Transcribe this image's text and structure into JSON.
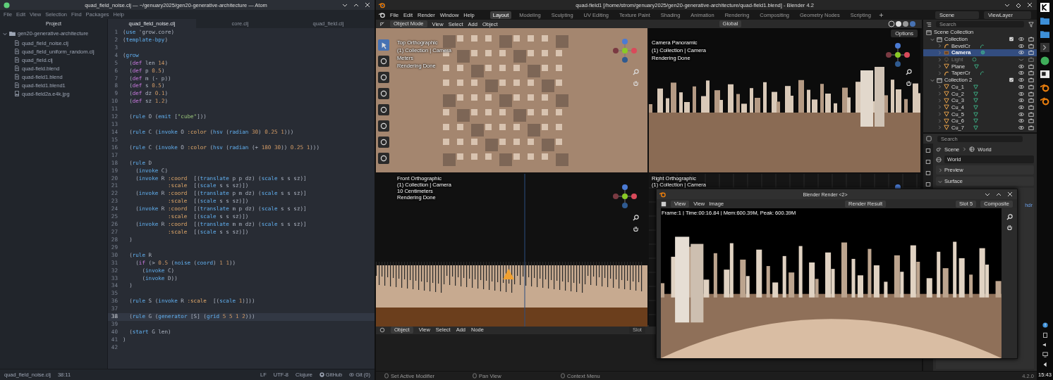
{
  "atom": {
    "title": "quad_field_noise.clj — ~/genuary2025/gen20-generative-architecture — Atom",
    "menu": [
      "File",
      "Edit",
      "View",
      "Selection",
      "Find",
      "Packages",
      "Help"
    ],
    "project": {
      "heading": "Project",
      "folder": {
        "name": "gen20-generative-architecture",
        "expanded": true,
        "children": [
          {
            "name": "quad_field_noise.clj",
            "kind": "file"
          },
          {
            "name": "quad_field_uniform_random.clj",
            "kind": "file"
          },
          {
            "name": "quad_field.clj",
            "kind": "file"
          },
          {
            "name": "quad-field.blend",
            "kind": "file"
          },
          {
            "name": "quad-field1.blend",
            "kind": "file"
          },
          {
            "name": "quad-field1.blend1",
            "kind": "file"
          },
          {
            "name": "quad-field2a.e4k.jpg",
            "kind": "image"
          }
        ]
      }
    },
    "tabs": [
      {
        "label": "quad_field_noise.clj",
        "selected": true
      },
      {
        "label": "core.clj",
        "selected": false
      },
      {
        "label": "quad_field.clj",
        "selected": false
      }
    ],
    "code": [
      {
        "no": "1",
        "current": false,
        "tokens": [
          {
            "kind": "p",
            "text": "("
          },
          {
            "kind": "fn",
            "text": "use"
          },
          {
            "kind": "p",
            "text": " 'grow.core)"
          }
        ]
      },
      {
        "no": "2",
        "current": false,
        "tokens": [
          {
            "kind": "p",
            "text": "("
          },
          {
            "kind": "fn",
            "text": "template-bpy"
          },
          {
            "kind": "p",
            "text": ")"
          }
        ]
      },
      {
        "no": "3",
        "current": false
      },
      {
        "no": "4",
        "current": false,
        "tokens": [
          {
            "kind": "p",
            "text": "("
          },
          {
            "kind": "fn",
            "text": "grow"
          }
        ]
      },
      {
        "no": "5",
        "current": false,
        "tokens": [
          {
            "kind": "p",
            "text": "  ("
          },
          {
            "kind": "kw",
            "text": "def"
          },
          {
            "kind": "p",
            "text": " len "
          },
          {
            "kind": "num",
            "text": "14"
          },
          {
            "kind": "p",
            "text": ")"
          }
        ]
      },
      {
        "no": "6",
        "current": false,
        "tokens": [
          {
            "kind": "p",
            "text": "  ("
          },
          {
            "kind": "kw",
            "text": "def"
          },
          {
            "kind": "p",
            "text": " p "
          },
          {
            "kind": "num",
            "text": "0.5"
          },
          {
            "kind": "p",
            "text": ")"
          }
        ]
      },
      {
        "no": "7",
        "current": false,
        "tokens": [
          {
            "kind": "p",
            "text": "  ("
          },
          {
            "kind": "kw",
            "text": "def"
          },
          {
            "kind": "p",
            "text": " m (- p))"
          }
        ]
      },
      {
        "no": "8",
        "current": false,
        "tokens": [
          {
            "kind": "p",
            "text": "  ("
          },
          {
            "kind": "kw",
            "text": "def"
          },
          {
            "kind": "p",
            "text": " s "
          },
          {
            "kind": "num",
            "text": "0.5"
          },
          {
            "kind": "p",
            "text": ")"
          }
        ]
      },
      {
        "no": "9",
        "current": false,
        "tokens": [
          {
            "kind": "p",
            "text": "  ("
          },
          {
            "kind": "kw",
            "text": "def"
          },
          {
            "kind": "p",
            "text": " dz "
          },
          {
            "kind": "num",
            "text": "0.1"
          },
          {
            "kind": "p",
            "text": ")"
          }
        ]
      },
      {
        "no": "10",
        "current": false,
        "tokens": [
          {
            "kind": "p",
            "text": "  ("
          },
          {
            "kind": "kw",
            "text": "def"
          },
          {
            "kind": "p",
            "text": " sz "
          },
          {
            "kind": "num",
            "text": "1.2"
          },
          {
            "kind": "p",
            "text": ")"
          }
        ]
      },
      {
        "no": "11",
        "current": false
      },
      {
        "no": "12",
        "current": false,
        "tokens": [
          {
            "kind": "p",
            "text": "  ("
          },
          {
            "kind": "fn",
            "text": "rule"
          },
          {
            "kind": "p",
            "text": " O ("
          },
          {
            "kind": "fn",
            "text": "emit"
          },
          {
            "kind": "p",
            "text": " ["
          },
          {
            "kind": "str",
            "text": "\"cube\""
          },
          {
            "kind": "p",
            "text": "]))"
          }
        ]
      },
      {
        "no": "13",
        "current": false
      },
      {
        "no": "14",
        "current": false,
        "tokens": [
          {
            "kind": "p",
            "text": "  ("
          },
          {
            "kind": "fn",
            "text": "rule"
          },
          {
            "kind": "p",
            "text": " C ("
          },
          {
            "kind": "fn",
            "text": "invoke"
          },
          {
            "kind": "p",
            "text": " O "
          },
          {
            "kind": "key",
            "text": ":color"
          },
          {
            "kind": "p",
            "text": " ("
          },
          {
            "kind": "fn",
            "text": "hsv"
          },
          {
            "kind": "p",
            "text": " ("
          },
          {
            "kind": "fn",
            "text": "radian "
          },
          {
            "kind": "num",
            "text": "30"
          },
          {
            "kind": "p",
            "text": ") "
          },
          {
            "kind": "num",
            "text": "0.25 "
          },
          {
            "kind": "num",
            "text": "1"
          },
          {
            "kind": "p",
            "text": ")))"
          }
        ]
      },
      {
        "no": "15",
        "current": false
      },
      {
        "no": "16",
        "current": false,
        "tokens": [
          {
            "kind": "p",
            "text": "  ("
          },
          {
            "kind": "fn",
            "text": "rule"
          },
          {
            "kind": "p",
            "text": " C ("
          },
          {
            "kind": "fn",
            "text": "invoke"
          },
          {
            "kind": "p",
            "text": " O "
          },
          {
            "kind": "key",
            "text": ":color"
          },
          {
            "kind": "p",
            "text": " ("
          },
          {
            "kind": "fn",
            "text": "hsv"
          },
          {
            "kind": "p",
            "text": " ("
          },
          {
            "kind": "fn",
            "text": "radian"
          },
          {
            "kind": "p",
            "text": " (+ "
          },
          {
            "kind": "num",
            "text": "180 "
          },
          {
            "kind": "num",
            "text": "30"
          },
          {
            "kind": "p",
            "text": ")) "
          },
          {
            "kind": "num",
            "text": "0.25 "
          },
          {
            "kind": "num",
            "text": "1"
          },
          {
            "kind": "p",
            "text": ")))"
          }
        ]
      },
      {
        "no": "17",
        "current": false
      },
      {
        "no": "18",
        "current": false,
        "tokens": [
          {
            "kind": "p",
            "text": "  ("
          },
          {
            "kind": "fn",
            "text": "rule"
          },
          {
            "kind": "p",
            "text": " D"
          }
        ]
      },
      {
        "no": "19",
        "current": false,
        "tokens": [
          {
            "kind": "p",
            "text": "    ("
          },
          {
            "kind": "fn",
            "text": "invoke"
          },
          {
            "kind": "p",
            "text": " C)"
          }
        ]
      },
      {
        "no": "20",
        "current": false,
        "tokens": [
          {
            "kind": "p",
            "text": "    ("
          },
          {
            "kind": "fn",
            "text": "invoke"
          },
          {
            "kind": "p",
            "text": " R "
          },
          {
            "kind": "key",
            "text": ":coord"
          },
          {
            "kind": "p",
            "text": "  [("
          },
          {
            "kind": "fn",
            "text": "translate"
          },
          {
            "kind": "p",
            "text": " p p dz) ("
          },
          {
            "kind": "fn",
            "text": "scale"
          },
          {
            "kind": "p",
            "text": " s s sz)]"
          }
        ]
      },
      {
        "no": "21",
        "current": false,
        "tokens": [
          {
            "kind": "key",
            "text": "              :scale"
          },
          {
            "kind": "p",
            "text": "  [("
          },
          {
            "kind": "fn",
            "text": "scale"
          },
          {
            "kind": "p",
            "text": " s s sz)])"
          }
        ]
      },
      {
        "no": "22",
        "current": false,
        "tokens": [
          {
            "kind": "p",
            "text": "    ("
          },
          {
            "kind": "fn",
            "text": "invoke"
          },
          {
            "kind": "p",
            "text": " R "
          },
          {
            "kind": "key",
            "text": ":coord"
          },
          {
            "kind": "p",
            "text": "  [("
          },
          {
            "kind": "fn",
            "text": "translate"
          },
          {
            "kind": "p",
            "text": " p m dz) ("
          },
          {
            "kind": "fn",
            "text": "scale"
          },
          {
            "kind": "p",
            "text": " s s sz)]"
          }
        ]
      },
      {
        "no": "23",
        "current": false,
        "tokens": [
          {
            "kind": "key",
            "text": "              :scale"
          },
          {
            "kind": "p",
            "text": "  [("
          },
          {
            "kind": "fn",
            "text": "scale"
          },
          {
            "kind": "p",
            "text": " s s sz)])"
          }
        ]
      },
      {
        "no": "24",
        "current": false,
        "tokens": [
          {
            "kind": "p",
            "text": "    ("
          },
          {
            "kind": "fn",
            "text": "invoke"
          },
          {
            "kind": "p",
            "text": " R "
          },
          {
            "kind": "key",
            "text": ":coord"
          },
          {
            "kind": "p",
            "text": "  [("
          },
          {
            "kind": "fn",
            "text": "translate"
          },
          {
            "kind": "p",
            "text": " m p dz) ("
          },
          {
            "kind": "fn",
            "text": "scale"
          },
          {
            "kind": "p",
            "text": " s s sz)]"
          }
        ]
      },
      {
        "no": "25",
        "current": false,
        "tokens": [
          {
            "kind": "key",
            "text": "              :scale"
          },
          {
            "kind": "p",
            "text": "  [("
          },
          {
            "kind": "fn",
            "text": "scale"
          },
          {
            "kind": "p",
            "text": " s s sz)])"
          }
        ]
      },
      {
        "no": "26",
        "current": false,
        "tokens": [
          {
            "kind": "p",
            "text": "    ("
          },
          {
            "kind": "fn",
            "text": "invoke"
          },
          {
            "kind": "p",
            "text": " R "
          },
          {
            "kind": "key",
            "text": ":coord"
          },
          {
            "kind": "p",
            "text": "  [("
          },
          {
            "kind": "fn",
            "text": "translate"
          },
          {
            "kind": "p",
            "text": " m m dz) ("
          },
          {
            "kind": "fn",
            "text": "scale"
          },
          {
            "kind": "p",
            "text": " s s sz)]"
          }
        ]
      },
      {
        "no": "27",
        "current": false,
        "tokens": [
          {
            "kind": "key",
            "text": "              :scale"
          },
          {
            "kind": "p",
            "text": "  [("
          },
          {
            "kind": "fn",
            "text": "scale"
          },
          {
            "kind": "p",
            "text": " s s sz)])"
          }
        ]
      },
      {
        "no": "28",
        "current": false,
        "tokens": [
          {
            "kind": "p",
            "text": "  )"
          }
        ]
      },
      {
        "no": "29",
        "current": false
      },
      {
        "no": "30",
        "current": false,
        "tokens": [
          {
            "kind": "p",
            "text": "  ("
          },
          {
            "kind": "fn",
            "text": "rule"
          },
          {
            "kind": "p",
            "text": " R"
          }
        ]
      },
      {
        "no": "31",
        "current": false,
        "tokens": [
          {
            "kind": "p",
            "text": "    ("
          },
          {
            "kind": "kw",
            "text": "if"
          },
          {
            "kind": "p",
            "text": " (> "
          },
          {
            "kind": "num",
            "text": "0.5"
          },
          {
            "kind": "p",
            "text": " ("
          },
          {
            "kind": "fn",
            "text": "noise"
          },
          {
            "kind": "p",
            "text": " ("
          },
          {
            "kind": "fn",
            "text": "coord"
          },
          {
            "kind": "p",
            "text": ") "
          },
          {
            "kind": "num",
            "text": "1 "
          },
          {
            "kind": "num",
            "text": "1"
          },
          {
            "kind": "p",
            "text": "))"
          }
        ]
      },
      {
        "no": "32",
        "current": false,
        "tokens": [
          {
            "kind": "p",
            "text": "      ("
          },
          {
            "kind": "fn",
            "text": "invoke"
          },
          {
            "kind": "p",
            "text": " C)"
          }
        ]
      },
      {
        "no": "33",
        "current": false,
        "tokens": [
          {
            "kind": "p",
            "text": "      ("
          },
          {
            "kind": "fn",
            "text": "invoke"
          },
          {
            "kind": "p",
            "text": " D))"
          }
        ]
      },
      {
        "no": "34",
        "current": false,
        "tokens": [
          {
            "kind": "p",
            "text": "  )"
          }
        ]
      },
      {
        "no": "35",
        "current": false
      },
      {
        "no": "36",
        "current": false,
        "tokens": [
          {
            "kind": "p",
            "text": "  ("
          },
          {
            "kind": "fn",
            "text": "rule"
          },
          {
            "kind": "p",
            "text": " S ("
          },
          {
            "kind": "fn",
            "text": "invoke"
          },
          {
            "kind": "p",
            "text": " R "
          },
          {
            "kind": "key",
            "text": ":scale"
          },
          {
            "kind": "p",
            "text": "  [("
          },
          {
            "kind": "fn",
            "text": "scale "
          },
          {
            "kind": "num",
            "text": "1"
          },
          {
            "kind": "p",
            "text": ")]))"
          }
        ]
      },
      {
        "no": "37",
        "current": false
      },
      {
        "no": "38",
        "current": true,
        "tokens": [
          {
            "kind": "p",
            "text": "  ("
          },
          {
            "kind": "fn",
            "text": "rule"
          },
          {
            "kind": "p",
            "text": " G ("
          },
          {
            "kind": "fn",
            "text": "generator"
          },
          {
            "kind": "p",
            "text": " [S] ("
          },
          {
            "kind": "fn",
            "text": "grid "
          },
          {
            "kind": "num",
            "text": "5 "
          },
          {
            "kind": "num",
            "text": "5 "
          },
          {
            "kind": "num",
            "text": "1 "
          },
          {
            "kind": "num",
            "text": "2"
          },
          {
            "kind": "p",
            "text": ")))"
          }
        ]
      },
      {
        "no": "39",
        "current": false
      },
      {
        "no": "40",
        "current": false,
        "tokens": [
          {
            "kind": "p",
            "text": "  ("
          },
          {
            "kind": "fn",
            "text": "start"
          },
          {
            "kind": "p",
            "text": " G len)"
          }
        ]
      },
      {
        "no": "41",
        "current": false,
        "tokens": [
          {
            "kind": "p",
            "text": ")"
          }
        ]
      },
      {
        "no": "42",
        "current": false
      }
    ],
    "status_bar": {
      "file": "quad_field_noise.clj",
      "cursor": "38:11",
      "items": [
        {
          "kind": "text",
          "label": "LF"
        },
        {
          "kind": "text",
          "label": "UTF-8"
        },
        {
          "kind": "text",
          "label": "Clojure"
        },
        {
          "kind": "github",
          "label": "GitHub"
        },
        {
          "kind": "git",
          "label": "Git (0)"
        }
      ]
    }
  },
  "blender": {
    "title": "quad-field1 [/home/strom/genuary2025/gen20-generative-architecture/quad-field1.blend] - Blender 4.2",
    "menu": [
      "File",
      "Edit",
      "Render",
      "Window",
      "Help"
    ],
    "workspaces": [
      {
        "label": "Layout",
        "selected": true
      },
      {
        "label": "Modeling",
        "selected": false
      },
      {
        "label": "Sculpting",
        "selected": false
      },
      {
        "label": "UV Editing",
        "selected": false
      },
      {
        "label": "Texture Paint",
        "selected": false
      },
      {
        "label": "Shading",
        "selected": false
      },
      {
        "label": "Animation",
        "selected": false
      },
      {
        "label": "Rendering",
        "selected": false
      },
      {
        "label": "Compositing",
        "selected": false
      },
      {
        "label": "Geometry Nodes",
        "selected": false
      },
      {
        "label": "Scripting",
        "selected": false
      }
    ],
    "scene": "Scene",
    "view_layer": "ViewLayer",
    "viewport_header": {
      "mode": "Object Mode",
      "menu": [
        "View",
        "Select",
        "Add",
        "Object"
      ],
      "orientation": "Global",
      "options": "Options"
    },
    "viewports": [
      {
        "kind": "top",
        "overlay": [
          "Top Orthographic",
          "(1) Collection | Camera",
          "Meters",
          "Rendering Done"
        ]
      },
      {
        "kind": "camera",
        "overlay": [
          "Camera Panoramic",
          "(1) Collection | Camera",
          "Rendering Done"
        ]
      },
      {
        "kind": "front",
        "overlay": [
          "Front Orthographic",
          "(1) Collection | Camera",
          "10 Centimeters",
          "Rendering Done"
        ]
      },
      {
        "kind": "right",
        "overlay": [
          "Right Orthographic",
          "(1) Collection | Camera"
        ]
      }
    ],
    "node_header": {
      "mode": "Object",
      "menu": [
        "View",
        "Select",
        "Add",
        "Node"
      ],
      "slot": "Slot"
    },
    "outliner": {
      "search": "Search",
      "root": "Scene Collection",
      "items": [
        {
          "name": "Collection",
          "kind": "collection",
          "expanded": true,
          "selected": false,
          "visible": true,
          "children": [
            {
              "name": "BevelCr",
              "kind": "curve",
              "expanded": false,
              "selected": false,
              "visible": true
            },
            {
              "name": "Camera",
              "kind": "camera",
              "expanded": false,
              "selected": true,
              "visible": true
            },
            {
              "name": "Light",
              "kind": "light",
              "expanded": false,
              "selected": false,
              "visible": false
            },
            {
              "name": "Plane",
              "kind": "mesh",
              "expanded": false,
              "selected": false,
              "visible": true
            },
            {
              "name": "TaperCr",
              "kind": "curve",
              "expanded": false,
              "selected": false,
              "visible": true
            }
          ]
        },
        {
          "name": "Collection 2",
          "kind": "collection",
          "expanded": true,
          "selected": false,
          "visible": true,
          "children": [
            {
              "name": "Cu_1",
              "kind": "mesh",
              "expanded": false,
              "selected": false,
              "visible": true
            },
            {
              "name": "Cu_2",
              "kind": "mesh",
              "expanded": false,
              "selected": false,
              "visible": true
            },
            {
              "name": "Cu_3",
              "kind": "mesh",
              "expanded": false,
              "selected": false,
              "visible": true
            },
            {
              "name": "Cu_4",
              "kind": "mesh",
              "expanded": false,
              "selected": false,
              "visible": true
            },
            {
              "name": "Cu_5",
              "kind": "mesh",
              "expanded": false,
              "selected": false,
              "visible": true
            },
            {
              "name": "Cu_6",
              "kind": "mesh",
              "expanded": false,
              "selected": false,
              "visible": true
            },
            {
              "name": "Cu_7",
              "kind": "mesh",
              "expanded": false,
              "selected": false,
              "visible": true
            }
          ]
        }
      ]
    },
    "properties": {
      "search": "Search",
      "breadcrumb": [
        "Scene",
        "World"
      ],
      "world": "World",
      "panels": [
        {
          "label": "Preview",
          "expanded": false
        },
        {
          "label": "Surface",
          "expanded": true
        }
      ],
      "link_text": "hdr"
    },
    "render_window": {
      "title": "Blender Render <2>",
      "view_menu": "View",
      "menu": [
        "View",
        "Image"
      ],
      "image_name": "Render Result",
      "slot": "Slot 5",
      "layer": "Composite",
      "info": "Frame:1 | Time:00:16.84 | Mem:600.39M, Peak: 600.39M"
    },
    "status_bar": {
      "hints": [
        "Set Active Modifier",
        "Pan View",
        "Context Menu"
      ],
      "version": "4.2.0"
    }
  },
  "taskbar": {
    "clock": "15:43"
  }
}
